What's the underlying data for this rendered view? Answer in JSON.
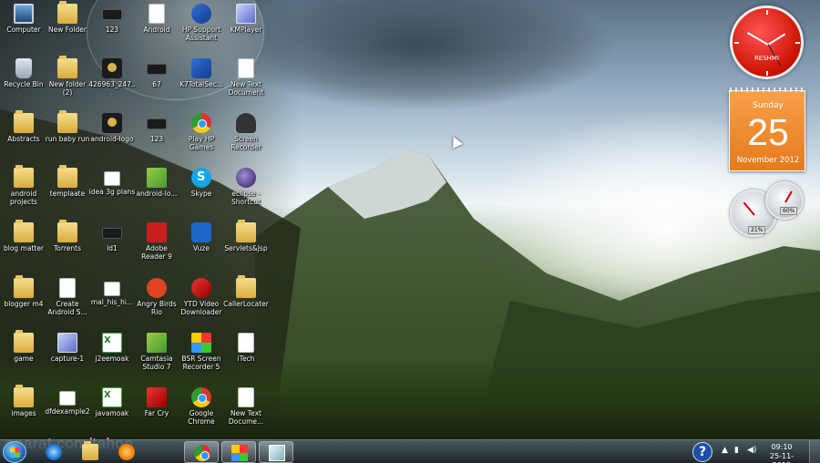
{
  "desktop": {
    "icons": [
      {
        "label": "Computer",
        "icon": "computer-icon"
      },
      {
        "label": "Recycle Bin",
        "icon": "recycle-bin-icon"
      },
      {
        "label": "Abstracts",
        "icon": "folder-icon"
      },
      {
        "label": "android projects",
        "icon": "folder-icon"
      },
      {
        "label": "blog matter",
        "icon": "folder-icon"
      },
      {
        "label": "blogger m4",
        "icon": "folder-icon"
      },
      {
        "label": "game",
        "icon": "folder-icon"
      },
      {
        "label": "images",
        "icon": "folder-icon"
      },
      {
        "label": "New Folder",
        "icon": "folder-icon"
      },
      {
        "label": "New folder (2)",
        "icon": "folder-icon"
      },
      {
        "label": "run baby run",
        "icon": "folder-icon"
      },
      {
        "label": "templaate",
        "icon": "folder-icon"
      },
      {
        "label": "Torrents",
        "icon": "folder-icon"
      },
      {
        "label": "Create Android S...",
        "icon": "document-icon"
      },
      {
        "label": "capture-1",
        "icon": "media-icon"
      },
      {
        "label": "dfdexample2",
        "icon": "image-icon"
      },
      {
        "label": "123",
        "icon": "video-file-icon"
      },
      {
        "label": "426963_247...",
        "icon": "bottle-icon"
      },
      {
        "label": "android-logo",
        "icon": "android-logo-icon"
      },
      {
        "label": "idea 3g plans",
        "icon": "image-icon"
      },
      {
        "label": "ld1",
        "icon": "video-file-icon"
      },
      {
        "label": "mal_his_hi...",
        "icon": "image-icon"
      },
      {
        "label": "j2eemoak",
        "icon": "excel-icon"
      },
      {
        "label": "javamoak",
        "icon": "excel-icon"
      },
      {
        "label": "Android",
        "icon": "word-icon"
      },
      {
        "label": "67",
        "icon": "video-file-icon"
      },
      {
        "label": "123",
        "icon": "video-file-icon"
      },
      {
        "label": "android-lo...",
        "icon": "android-icon"
      },
      {
        "label": "Adobe Reader 9",
        "icon": "adobe-reader-icon"
      },
      {
        "label": "Angry Birds Rio",
        "icon": "angry-birds-icon"
      },
      {
        "label": "Camtasia Studio 7",
        "icon": "camtasia-icon"
      },
      {
        "label": "Far Cry",
        "icon": "far-cry-icon"
      },
      {
        "label": "HP Support Assistant",
        "icon": "hp-icon"
      },
      {
        "label": "K7TotalSec...",
        "icon": "k7-icon"
      },
      {
        "label": "Play HP Games",
        "icon": "games-icon"
      },
      {
        "label": "Skype",
        "icon": "skype-icon"
      },
      {
        "label": "Vuze",
        "icon": "vuze-icon"
      },
      {
        "label": "YTD Video Downloader",
        "icon": "ytd-icon"
      },
      {
        "label": "BSR Screen Recorder 5",
        "icon": "bsr-icon"
      },
      {
        "label": "Google Chrome",
        "icon": "chrome-icon"
      },
      {
        "label": "KMPlayer",
        "icon": "kmplayer-icon"
      },
      {
        "label": "New Text Document",
        "icon": "text-document-icon"
      },
      {
        "label": "Screen Recorder",
        "icon": "screen-recorder-icon"
      },
      {
        "label": "eclipse - Shortcut",
        "icon": "eclipse-icon"
      },
      {
        "label": "Servlets&Jsp",
        "icon": "folder-icon"
      },
      {
        "label": "CallerLocater",
        "icon": "folder-icon"
      },
      {
        "label": "iTech",
        "icon": "itech-icon"
      },
      {
        "label": "New Text Docume...",
        "icon": "text-document-icon"
      }
    ]
  },
  "gadgets": {
    "clock": {
      "name": "RESHMI"
    },
    "calendar": {
      "day": "Sunday",
      "date": "25",
      "month_year": "November 2012"
    },
    "cpu_meter": {
      "cpu": "21%",
      "memory": "60%"
    }
  },
  "watermark": "aparat.com/tahoo",
  "taskbar": {
    "pinned": [
      "internet-explorer-icon",
      "windows-explorer-icon",
      "media-player-icon",
      "chrome-icon",
      "paint-icon",
      "window-switcher-icon"
    ],
    "tray": {
      "help": "?",
      "time": "09:10",
      "date": "25-11-2012"
    }
  }
}
